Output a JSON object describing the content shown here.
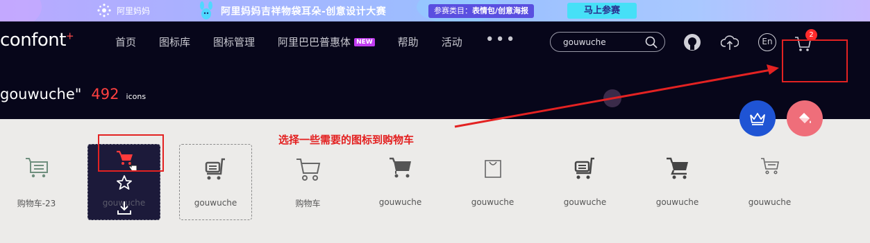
{
  "banner": {
    "brand": "阿里妈妈",
    "title": "阿里妈妈吉祥物袋耳朵-创意设计大赛",
    "category_label": "参赛类目：",
    "category_value": "表情包/创意海报",
    "join_button": "马上参赛"
  },
  "header": {
    "logo_text": "confont",
    "logo_mark": "+",
    "nav": [
      "首页",
      "图标库",
      "图标管理",
      "阿里巴巴普惠体",
      "帮助",
      "活动"
    ],
    "new_badge": "NEW",
    "more": "•••",
    "search_value": "gouwuche",
    "lang": "En",
    "cart_count": "2"
  },
  "result": {
    "query": "gouwuche\"",
    "count": "492",
    "unit": "icons"
  },
  "annotation": "选择一些需要的图标到购物车",
  "icons": [
    {
      "label": "购物车-23",
      "icon": "cart-basket-icon"
    },
    {
      "label": "gouwuche",
      "icon": "add-to-cart-icon"
    },
    {
      "label": "gouwuche",
      "icon": "cart-list-icon"
    },
    {
      "label": "购物车",
      "icon": "cart-outline-icon"
    },
    {
      "label": "gouwuche",
      "icon": "cart-solid-icon"
    },
    {
      "label": "gouwuche",
      "icon": "shopping-bag-icon"
    },
    {
      "label": "gouwuche",
      "icon": "cart-list-icon"
    },
    {
      "label": "gouwuche",
      "icon": "cart-filled-icon"
    },
    {
      "label": "gouwuche",
      "icon": "cart-small-icon"
    }
  ],
  "colors": {
    "header_bg": "#07061a",
    "accent_red": "#e32222",
    "fab_blue": "#1f54d4",
    "fab_pink": "#ef6e7a"
  }
}
